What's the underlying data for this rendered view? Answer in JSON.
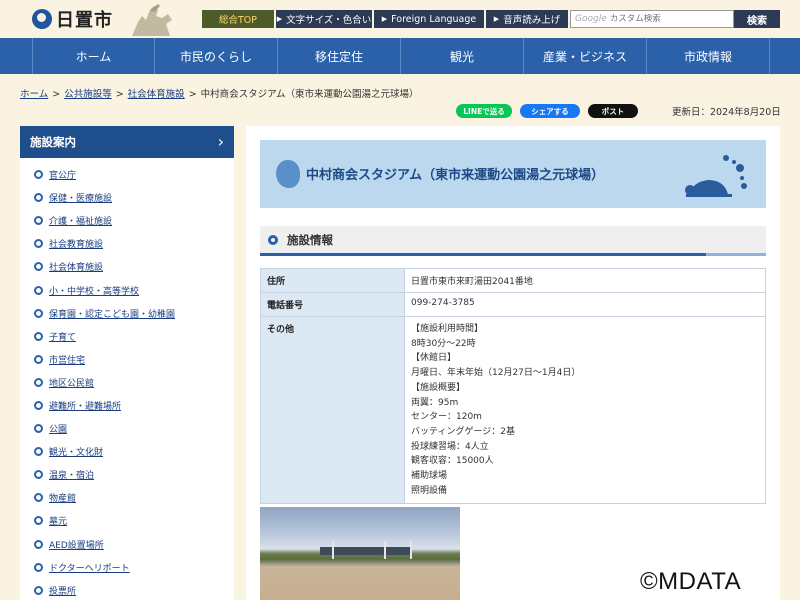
{
  "header": {
    "site_title": "日置市",
    "top_buttons": [
      "総合TOP",
      "文字サイズ・色合い",
      "Foreign Language",
      "音声読み上げ"
    ],
    "search": {
      "google_label": "Google",
      "placeholder": "カスタム検索",
      "button_label": "検索"
    }
  },
  "gnav": [
    "ホーム",
    "市民のくらし",
    "移住定住",
    "観光",
    "産業・ビジネス",
    "市政情報"
  ],
  "breadcrumb": {
    "links": [
      "ホーム",
      "公共施設等",
      "社会体育施設"
    ],
    "separator": ">",
    "current": "中村商会スタジアム（東市来運動公園湯之元球場）"
  },
  "share": {
    "line": "LINEで送る",
    "facebook": "シェアする",
    "x": "ポスト"
  },
  "updated": "更新日：2024年8月20日",
  "sidebar": {
    "title": "施設案内",
    "items": [
      "官公庁",
      "保健・医療施設",
      "介護・福祉施設",
      "社会教育施設",
      "社会体育施設",
      "小・中学校・高等学校",
      "保育園・認定こども園・幼稚園",
      "子育て",
      "市営住宅",
      "地区公民館",
      "避難所・避難場所",
      "公園",
      "観光・文化財",
      "温泉・宿泊",
      "物産館",
      "墓元",
      "AED設置場所",
      "ドクターヘリポート",
      "投票所"
    ]
  },
  "main": {
    "banner_title": "中村商会スタジアム（東市来運動公園湯之元球場）",
    "section_title": "施設情報",
    "table": {
      "address_label": "住所",
      "address": "日置市東市来町湯田2041番地",
      "phone_label": "電話番号",
      "phone": "099-274-3785",
      "other_label": "その他",
      "other_lines": [
        "【施設利用時間】",
        "8時30分～22時",
        "【休館日】",
        "月曜日、年末年始（12月27日～1月4日）",
        "【施設概要】",
        "両翼：95m",
        "センター：120m",
        "バッティングゲージ：2基",
        "投球練習場：4人立",
        "観客収容：15000人",
        "補助球場",
        "照明設備"
      ]
    }
  },
  "copyright": "©MDATA",
  "colors": {
    "nav_blue": "#2a61a8",
    "sidebar_head": "#1e4e8c",
    "bg_beige": "#fbf3e2",
    "banner_blue": "#bcd8ef"
  }
}
